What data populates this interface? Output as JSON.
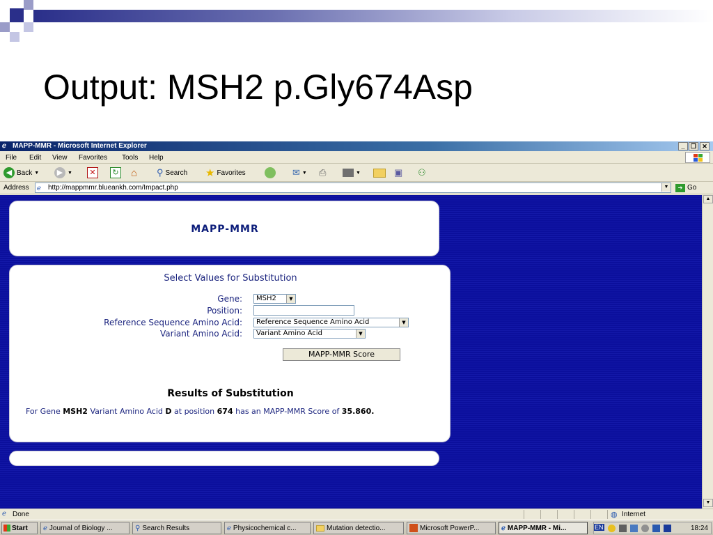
{
  "slide": {
    "title": "Output: MSH2 p.Gly674Asp"
  },
  "browser": {
    "window_title": "MAPP-MMR - Microsoft Internet Explorer",
    "menu": [
      "File",
      "Edit",
      "View",
      "Favorites",
      "Tools",
      "Help"
    ],
    "toolbar": {
      "back": "Back",
      "search": "Search",
      "favorites": "Favorites"
    },
    "address_label": "Address",
    "url": "http://mappmmr.blueankh.com/Impact.php",
    "go_label": "Go",
    "status_text": "Done",
    "zone_text": "Internet"
  },
  "page": {
    "app_title": "MAPP-MMR",
    "form_heading": "Select Values for Substitution",
    "gene_label": "Gene:",
    "gene_value": "MSH2",
    "position_label": "Position:",
    "position_value": "",
    "ref_label": "Reference Sequence Amino Acid:",
    "ref_value": "Reference Sequence Amino Acid",
    "variant_label": "Variant Amino Acid:",
    "variant_value": "Variant Amino Acid",
    "score_button": "MAPP-MMR Score",
    "results_heading": "Results of Substitution",
    "results": {
      "t1": "For Gene ",
      "gene": "MSH2",
      "t2": " Variant Amino Acid ",
      "aa": "D",
      "t3": " at position ",
      "pos": "674",
      "t4": " has an MAPP-MMR Score of ",
      "score": "35.860",
      "t5": "."
    }
  },
  "taskbar": {
    "start": "Start",
    "tasks": [
      "Journal of Biology ...",
      "Search Results",
      "Physicochemical c...",
      "Mutation detectio...",
      "Microsoft PowerP...",
      "MAPP-MMR - Mi..."
    ],
    "tray_lang": "EN",
    "time": "18:24"
  },
  "colors": {
    "page_background": "#0b0f9c",
    "title_blue": "#0b1c7a"
  }
}
